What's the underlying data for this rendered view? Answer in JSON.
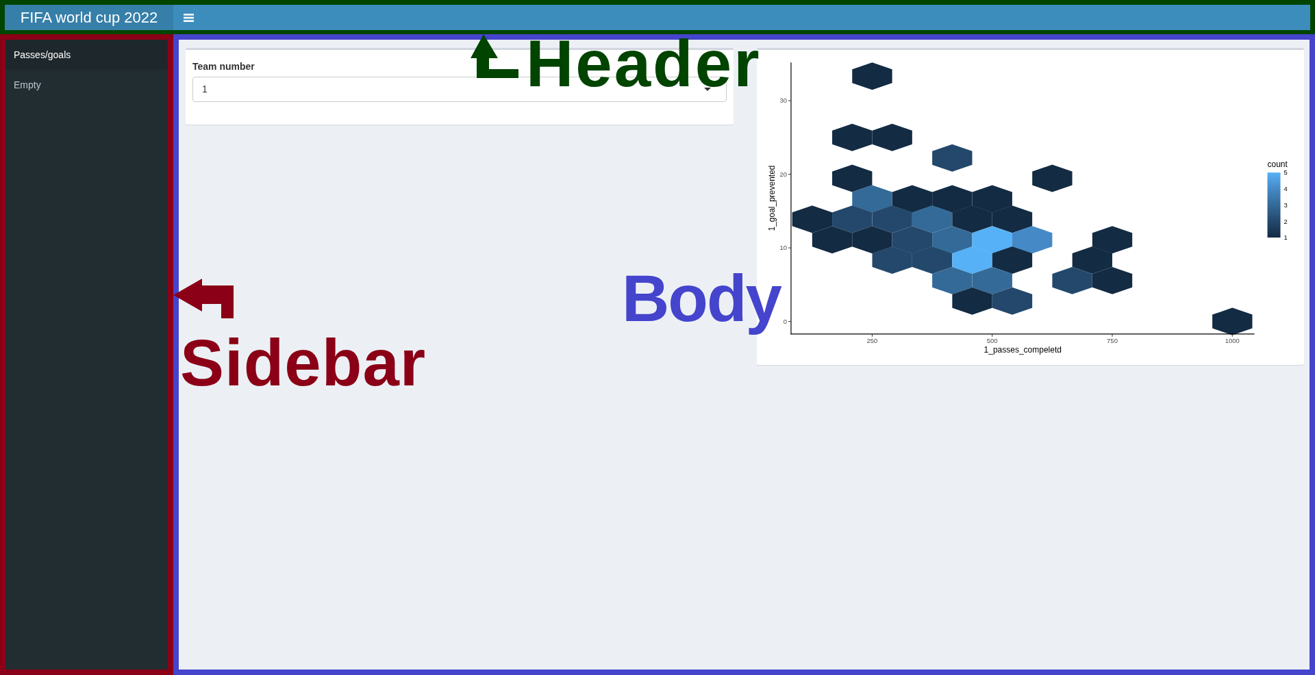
{
  "header": {
    "title": "FIFA world cup 2022"
  },
  "sidebar": {
    "items": [
      {
        "label": "Passes/goals",
        "selected": true
      },
      {
        "label": "Empty",
        "selected": false
      }
    ]
  },
  "body": {
    "input_card": {
      "label": "Team number",
      "value": "1"
    },
    "plot_card": {
      "y_axis_title": "1_goal_prevented",
      "y_ticks": [
        "30",
        "20",
        "10",
        "0"
      ],
      "x_ticks": [
        "250",
        "500",
        "750",
        "1000"
      ],
      "x_axis_title": "1_passes_compeletd",
      "legend": {
        "title": "count",
        "items": [
          {
            "label": "5",
            "color": "#56b1f7"
          },
          {
            "label": "4",
            "color": "#4589c6"
          },
          {
            "label": "3",
            "color": "#336a98"
          },
          {
            "label": "2",
            "color": "#23486c"
          },
          {
            "label": "1",
            "color": "#132b43"
          }
        ]
      }
    }
  },
  "annotations": [
    {
      "kind": "header",
      "label": "Header",
      "color": "#004400"
    },
    {
      "kind": "body",
      "label": "Body",
      "color": "#4444cc"
    },
    {
      "kind": "sidebar",
      "label": "Sidebar",
      "color": "#8b0016"
    }
  ]
}
